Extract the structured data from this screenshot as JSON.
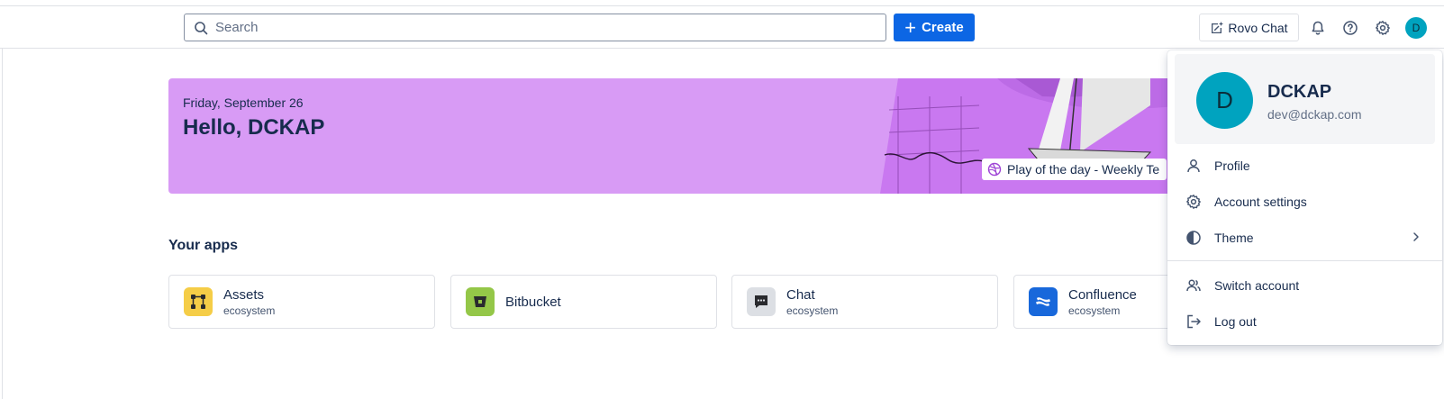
{
  "search": {
    "placeholder": "Search"
  },
  "toolbar": {
    "create_label": "Create",
    "rovo_label": "Rovo Chat",
    "avatar_initial": "D",
    "accent_color": "#0c66e4",
    "avatar_color": "#00a3bf"
  },
  "banner": {
    "date": "Friday, September 26",
    "greeting": "Hello, DCKAP",
    "play_of_day": "Play of the day - Weekly Te",
    "background_color": "#d89bf5"
  },
  "apps": {
    "title": "Your apps",
    "items": [
      {
        "name": "Assets",
        "subtitle": "ecosystem",
        "icon": "assets-icon",
        "color": "#f5cd47"
      },
      {
        "name": "Bitbucket",
        "subtitle": "",
        "icon": "bitbucket-icon",
        "color": "#94c748"
      },
      {
        "name": "Chat",
        "subtitle": "ecosystem",
        "icon": "chat-icon",
        "color": "#dcdfe4"
      },
      {
        "name": "Confluence",
        "subtitle": "ecosystem",
        "icon": "confluence-icon",
        "color": "#1868db"
      }
    ]
  },
  "account_menu": {
    "initial": "D",
    "name": "DCKAP",
    "email": "dev@dckap.com",
    "items": [
      {
        "label": "Profile",
        "icon": "person-icon"
      },
      {
        "label": "Account settings",
        "icon": "gear-icon"
      },
      {
        "label": "Theme",
        "icon": "theme-icon"
      },
      {
        "label": "Switch account",
        "icon": "switch-account-icon"
      },
      {
        "label": "Log out",
        "icon": "log-out-icon"
      }
    ]
  }
}
